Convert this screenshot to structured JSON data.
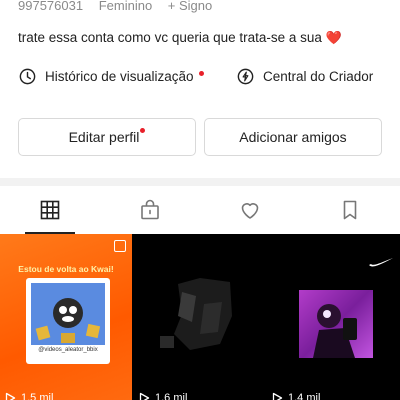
{
  "profile": {
    "id": "997576031",
    "gender": "Feminino",
    "sign": "+ Signo",
    "bio": "trate essa conta como vc queria que trata-se a sua",
    "bio_emoji": "❤️"
  },
  "links": {
    "history_label": "Histórico de visualização",
    "creator_label": "Central do Criador"
  },
  "buttons": {
    "edit_label": "Editar perfil",
    "add_label": "Adicionar amigos"
  },
  "tabs": [
    {
      "icon": "grid-icon"
    },
    {
      "icon": "lock-bag-icon"
    },
    {
      "icon": "heart-icon"
    },
    {
      "icon": "bookmark-icon"
    }
  ],
  "videos": [
    {
      "title": "Estou de volta ao Kwai!",
      "username": "@videos_aleator_bbix",
      "views": "1,5 mil"
    },
    {
      "views": "1,6 mil"
    },
    {
      "views": "1,4 mil"
    }
  ],
  "colors": {
    "accent_red": "#e8202a",
    "kwai_orange": "#ff5a00"
  }
}
